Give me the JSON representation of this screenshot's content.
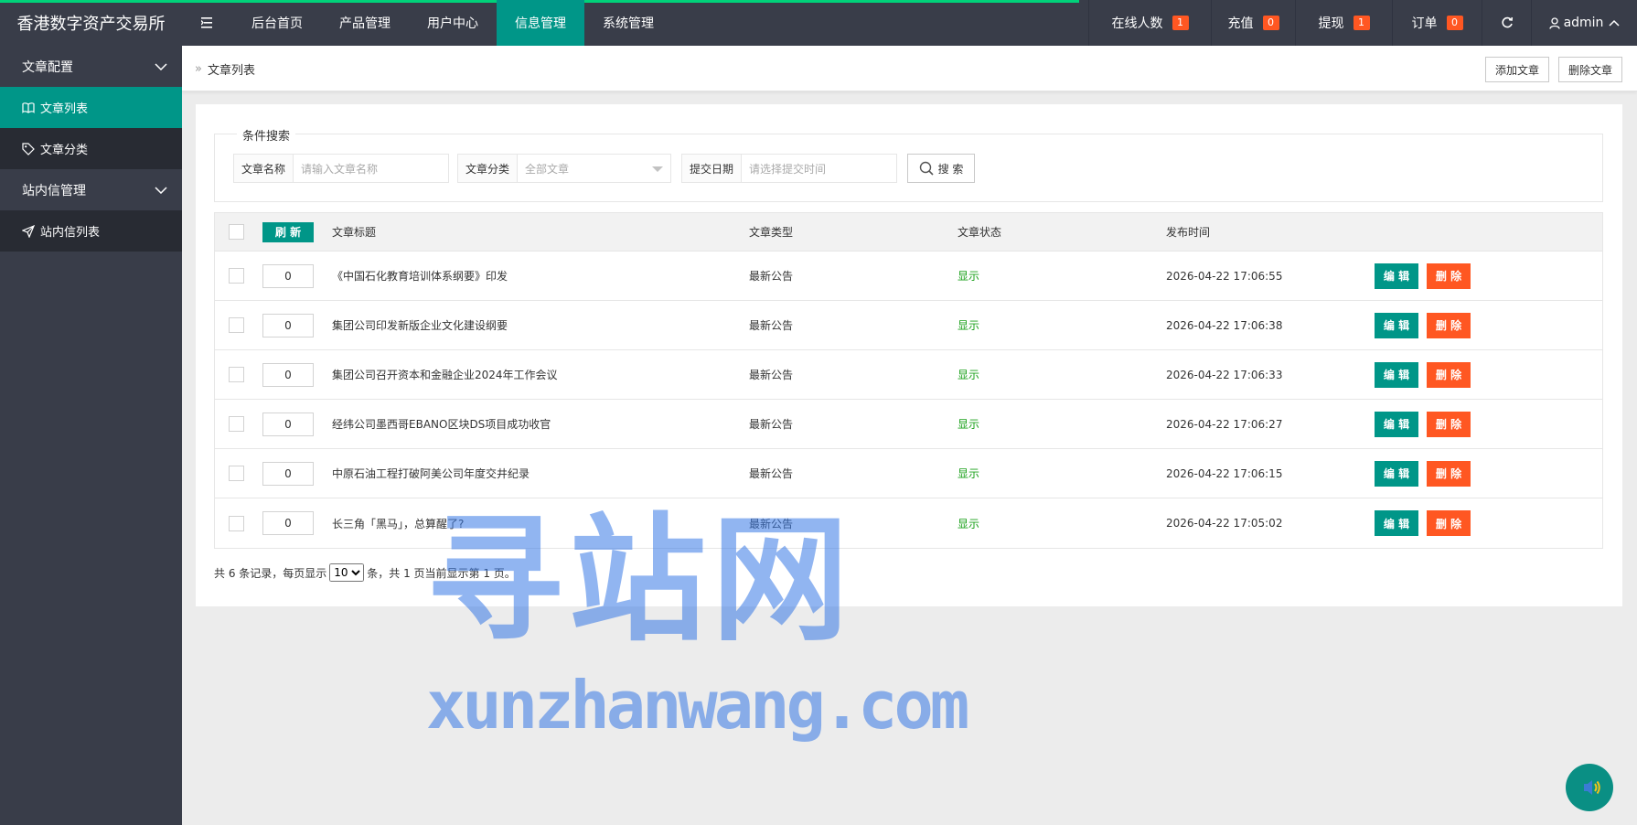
{
  "app": {
    "title": "香港数字资产交易所"
  },
  "topnav": {
    "items": [
      {
        "label": "后台首页"
      },
      {
        "label": "产品管理"
      },
      {
        "label": "用户中心"
      },
      {
        "label": "信息管理"
      },
      {
        "label": "系统管理"
      }
    ],
    "active": "信息管理",
    "right": {
      "online": {
        "label": "在线人数",
        "count": "1"
      },
      "recharge": {
        "label": "充值",
        "count": "0"
      },
      "withdraw": {
        "label": "提现",
        "count": "1"
      },
      "orders": {
        "label": "订单",
        "count": "0"
      },
      "user": "admin"
    }
  },
  "sidebar": {
    "groups": [
      {
        "label": "文章配置",
        "items": [
          {
            "label": "文章列表",
            "icon": "book-icon",
            "active": true
          },
          {
            "label": "文章分类",
            "icon": "tag-icon"
          }
        ]
      },
      {
        "label": "站内信管理",
        "items": [
          {
            "label": "站内信列表",
            "icon": "send-icon"
          }
        ]
      }
    ]
  },
  "breadcrumb": {
    "label": "文章列表"
  },
  "header_buttons": {
    "add": "添加文章",
    "delete": "删除文章"
  },
  "search": {
    "legend": "条件搜索",
    "name_label": "文章名称",
    "name_placeholder": "请输入文章名称",
    "category_label": "文章分类",
    "category_value": "全部文章",
    "date_label": "提交日期",
    "date_placeholder": "请选择提交时间",
    "button": "搜 索"
  },
  "table": {
    "refresh": "刷 新",
    "headers": {
      "title": "文章标题",
      "type": "文章类型",
      "status": "文章状态",
      "time": "发布时间"
    },
    "edit_label": "编 辑",
    "delete_label": "删 除",
    "rows": [
      {
        "sort": "0",
        "title": "《中国石化教育培训体系纲要》印发",
        "type": "最新公告",
        "status": "显示",
        "time": "2026-04-22 17:06:55"
      },
      {
        "sort": "0",
        "title": "集团公司印发新版企业文化建设纲要",
        "type": "最新公告",
        "status": "显示",
        "time": "2026-04-22 17:06:38"
      },
      {
        "sort": "0",
        "title": "集团公司召开资本和金融企业2024年工作会议",
        "type": "最新公告",
        "status": "显示",
        "time": "2026-04-22 17:06:33"
      },
      {
        "sort": "0",
        "title": "经纬公司墨西哥EBANO区块DS项目成功收官",
        "type": "最新公告",
        "status": "显示",
        "time": "2026-04-22 17:06:27"
      },
      {
        "sort": "0",
        "title": "中原石油工程打破阿美公司年度交井纪录",
        "type": "最新公告",
        "status": "显示",
        "time": "2026-04-22 17:06:15"
      },
      {
        "sort": "0",
        "title": "长三角「黑马」，总算醒了?",
        "type": "最新公告",
        "status": "显示",
        "time": "2026-04-22 17:05:02"
      }
    ]
  },
  "pager": {
    "prefix": "共 6 条记录，每页显示",
    "page_size": "10",
    "suffix": "条，共 1 页当前显示第 1 页。"
  },
  "watermark": {
    "cn": "寻站网",
    "en": "xunzhanwang.com"
  },
  "colors": {
    "primary": "#009688",
    "danger": "#ff5722",
    "dark": "#393d49",
    "status": "#1aa01a"
  }
}
